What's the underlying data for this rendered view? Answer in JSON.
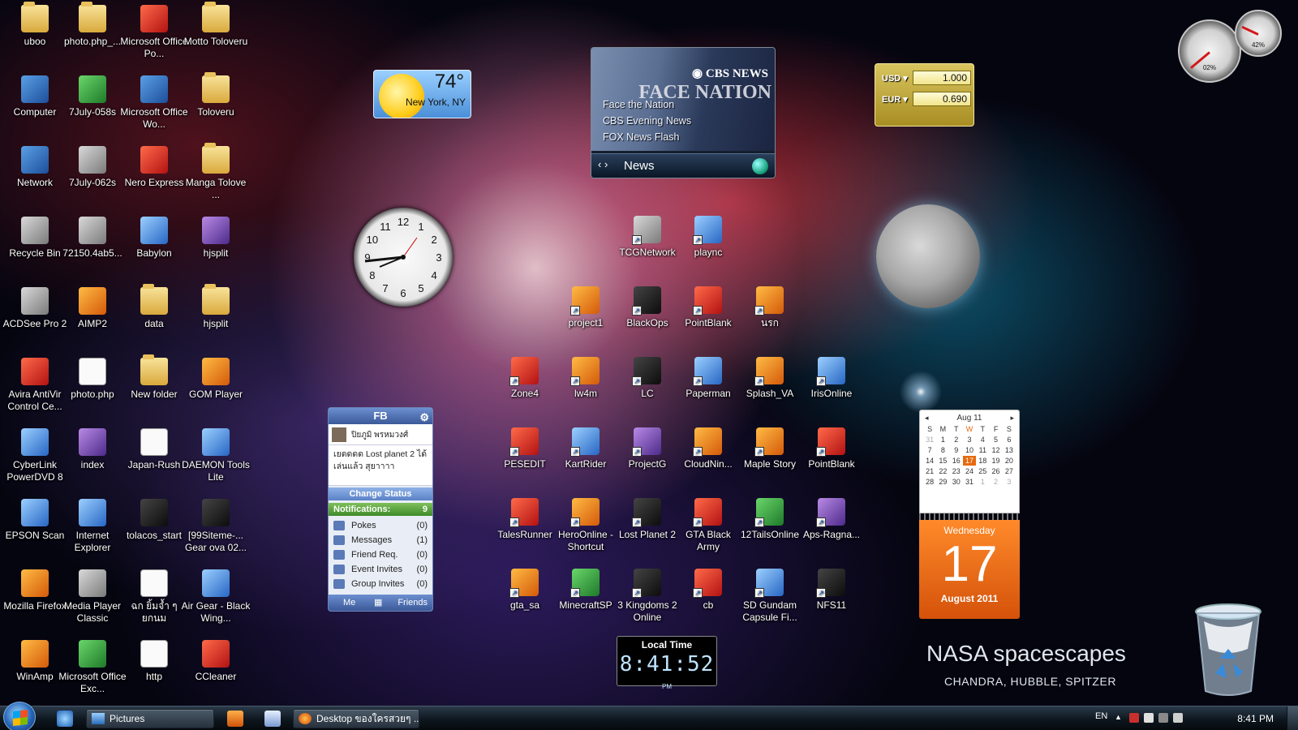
{
  "desktop_icons": [
    {
      "label": "uboo",
      "kind": "folder"
    },
    {
      "label": "photo.php_...",
      "kind": "folder"
    },
    {
      "label": "Microsoft Office Po...",
      "kind": "red"
    },
    {
      "label": "Motto Toloveru",
      "kind": "folder"
    },
    {
      "label": "Computer",
      "kind": "app"
    },
    {
      "label": "7July-058s",
      "kind": "green"
    },
    {
      "label": "Microsoft Office Wo...",
      "kind": "app"
    },
    {
      "label": "Toloveru",
      "kind": "folder"
    },
    {
      "label": "Network",
      "kind": "app"
    },
    {
      "label": "7July-062s",
      "kind": "gray"
    },
    {
      "label": "Nero Express",
      "kind": "red"
    },
    {
      "label": "Manga Tolove ...",
      "kind": "folder"
    },
    {
      "label": "Recycle Bin",
      "kind": "gray"
    },
    {
      "label": "72150.4ab5...",
      "kind": "gray"
    },
    {
      "label": "Babylon",
      "kind": "blue"
    },
    {
      "label": "hjsplit",
      "kind": "purple"
    },
    {
      "label": "ACDSee Pro 2",
      "kind": "gray"
    },
    {
      "label": "AIMP2",
      "kind": "orange"
    },
    {
      "label": "data",
      "kind": "folder"
    },
    {
      "label": "hjsplit",
      "kind": "folder"
    },
    {
      "label": "Avira AntiVir Control Ce...",
      "kind": "red"
    },
    {
      "label": "photo.php",
      "kind": "doc"
    },
    {
      "label": "New folder",
      "kind": "folder"
    },
    {
      "label": "GOM Player",
      "kind": "orange"
    },
    {
      "label": "CyberLink PowerDVD 8",
      "kind": "blue"
    },
    {
      "label": "index",
      "kind": "purple"
    },
    {
      "label": "Japan-Rush",
      "kind": "doc"
    },
    {
      "label": "DAEMON Tools Lite",
      "kind": "blue"
    },
    {
      "label": "EPSON Scan",
      "kind": "blue"
    },
    {
      "label": "Internet Explorer",
      "kind": "blue"
    },
    {
      "label": "tolacos_start",
      "kind": "dark"
    },
    {
      "label": "[99Siteme-... Gear ova 02...",
      "kind": "dark"
    },
    {
      "label": "Mozilla Firefox",
      "kind": "orange"
    },
    {
      "label": "Media Player Classic",
      "kind": "gray"
    },
    {
      "label": "ฉก ยิ้มจ้ำ ๆ ยกนม",
      "kind": "doc"
    },
    {
      "label": "Air Gear - Black Wing...",
      "kind": "blue"
    },
    {
      "label": "WinAmp",
      "kind": "orange"
    },
    {
      "label": "Microsoft Office Exc...",
      "kind": "green"
    },
    {
      "label": "http",
      "kind": "doc"
    },
    {
      "label": "CCleaner",
      "kind": "red"
    }
  ],
  "game_icons": [
    {
      "label": "TCGNetwork",
      "kind": "gray"
    },
    {
      "label": "plaync",
      "kind": "blue"
    },
    {
      "label": "project1",
      "kind": "orange"
    },
    {
      "label": "BlackOps",
      "kind": "dark"
    },
    {
      "label": "PointBlank",
      "kind": "red"
    },
    {
      "label": "นรก",
      "kind": "orange"
    },
    {
      "label": "Zone4",
      "kind": "red"
    },
    {
      "label": "lw4m",
      "kind": "orange"
    },
    {
      "label": "LC",
      "kind": "dark"
    },
    {
      "label": "Paperman",
      "kind": "blue"
    },
    {
      "label": "Splash_VA",
      "kind": "orange"
    },
    {
      "label": "IrisOnline",
      "kind": "blue"
    },
    {
      "label": "PESEDIT",
      "kind": "red"
    },
    {
      "label": "KartRider",
      "kind": "blue"
    },
    {
      "label": "ProjectG",
      "kind": "purple"
    },
    {
      "label": "CloudNin...",
      "kind": "orange"
    },
    {
      "label": "Maple Story",
      "kind": "orange"
    },
    {
      "label": "PointBlank",
      "kind": "red"
    },
    {
      "label": "TalesRunner",
      "kind": "red"
    },
    {
      "label": "HeroOnline - Shortcut",
      "kind": "orange"
    },
    {
      "label": "Lost Planet 2",
      "kind": "dark"
    },
    {
      "label": "GTA Black Army",
      "kind": "red"
    },
    {
      "label": "12TailsOnline",
      "kind": "green"
    },
    {
      "label": "Aps-Ragna...",
      "kind": "purple"
    },
    {
      "label": "gta_sa",
      "kind": "orange"
    },
    {
      "label": "MinecraftSP",
      "kind": "green"
    },
    {
      "label": "3 Kingdoms 2 Online",
      "kind": "dark"
    },
    {
      "label": "cb",
      "kind": "red"
    },
    {
      "label": "SD Gundam Capsule Fi...",
      "kind": "blue"
    },
    {
      "label": "NFS11",
      "kind": "dark"
    }
  ],
  "weather": {
    "temp": "74°",
    "city": "New York, NY"
  },
  "news": {
    "brand": "◉ CBS NEWS",
    "banner": "FACE NATION",
    "items": [
      "Face the Nation",
      "CBS Evening News",
      "FOX News Flash"
    ],
    "nav": "‹ ›",
    "title": "News"
  },
  "currency": {
    "rows": [
      {
        "code": "USD ▾",
        "value": "1.000"
      },
      {
        "code": "EUR ▾",
        "value": "0.690"
      }
    ]
  },
  "cpu_meter": {
    "cpu": "02%",
    "memory": "42%"
  },
  "clock": {
    "numerals": [
      "12",
      "1",
      "2",
      "3",
      "4",
      "5",
      "6",
      "7",
      "8",
      "9",
      "10",
      "11"
    ]
  },
  "facebook": {
    "title": "FB",
    "user_name": "ปิยภูมิ พรหมวงศ์",
    "status_text": "เยดดดด Lost planet 2 ได้เล่นแล้ว สุยาาาา",
    "change_status": "Change Status",
    "notifications_label": "Notifications:",
    "notifications_count": "9",
    "items": [
      {
        "label": "Pokes",
        "count": "(0)"
      },
      {
        "label": "Messages",
        "count": "(1)"
      },
      {
        "label": "Friend Req.",
        "count": "(0)"
      },
      {
        "label": "Event Invites",
        "count": "(0)"
      },
      {
        "label": "Group Invites",
        "count": "(0)"
      }
    ],
    "footer_me": "Me",
    "footer_friends": "Friends"
  },
  "calendar": {
    "month_year": "Aug 11",
    "weekdays": [
      "S",
      "M",
      "T",
      "W",
      "T",
      "F",
      "S"
    ],
    "days": [
      "31",
      "1",
      "2",
      "3",
      "4",
      "5",
      "6",
      "7",
      "8",
      "9",
      "10",
      "11",
      "12",
      "13",
      "14",
      "15",
      "16",
      "17",
      "18",
      "19",
      "20",
      "21",
      "22",
      "23",
      "24",
      "25",
      "26",
      "27",
      "28",
      "29",
      "30",
      "31",
      "1",
      "2",
      "3"
    ],
    "weekday": "Wednesday",
    "day": "17",
    "month_full": "August 2011"
  },
  "local_time": {
    "label": "Local Time",
    "time": "8:41:52",
    "ampm": "PM"
  },
  "wallpaper": {
    "title": "NASA spacescapes",
    "subtitle": "CHANDRA, HUBBLE, SPITZER"
  },
  "taskbar": {
    "tasks": [
      "Pictures",
      "Desktop ของใครสวยๆ ..."
    ],
    "lang": "EN",
    "time": "8:41 PM"
  }
}
